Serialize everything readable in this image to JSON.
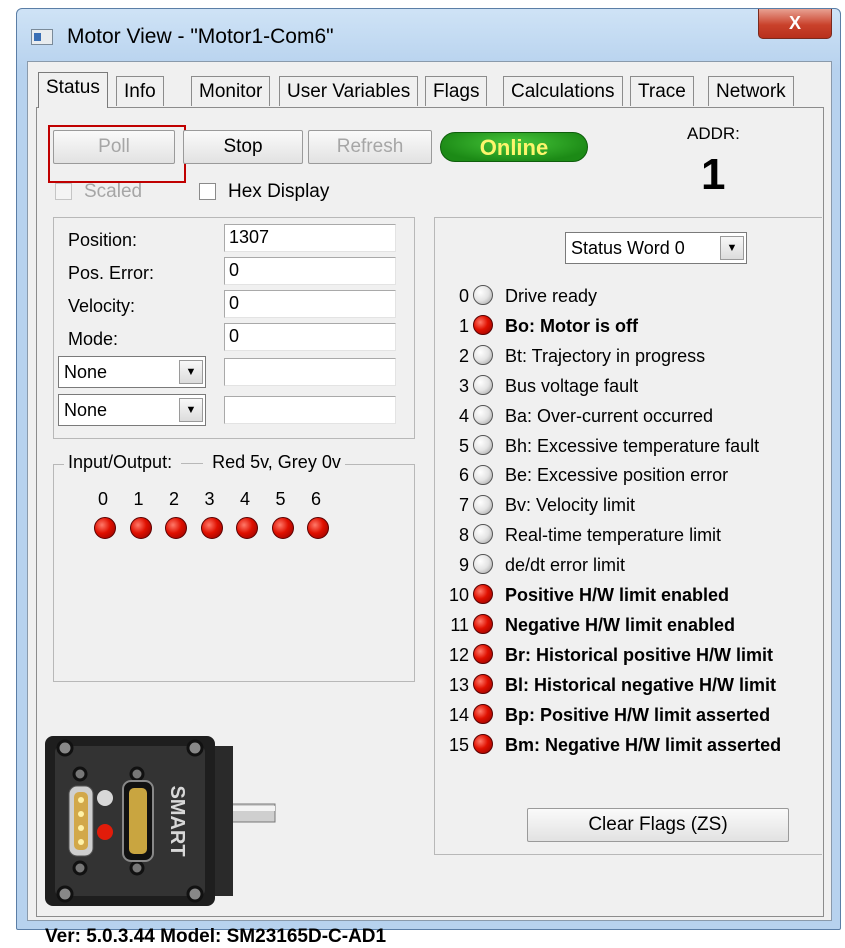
{
  "window": {
    "title": "Motor View - \"Motor1-Com6\"",
    "close_label": "X"
  },
  "tabs": [
    "Status",
    "Info",
    "Monitor",
    "User Variables",
    "Flags",
    "Calculations",
    "Trace",
    "Network"
  ],
  "toolbar": {
    "poll": "Poll",
    "stop": "Stop",
    "refresh": "Refresh",
    "online": "Online",
    "addr_label": "ADDR:",
    "addr_value": "1"
  },
  "options": {
    "scaled": "Scaled",
    "hex_display": "Hex Display"
  },
  "fields": [
    {
      "label": "Position:",
      "value": "1307"
    },
    {
      "label": "Pos. Error:",
      "value": "0"
    },
    {
      "label": "Velocity:",
      "value": "0"
    },
    {
      "label": "Mode:",
      "value": "0"
    }
  ],
  "selectors": [
    {
      "value": "None",
      "text": ""
    },
    {
      "value": "None",
      "text": ""
    }
  ],
  "io": {
    "title": "Input/Output:",
    "legend": "Red 5v, Grey 0v",
    "pins": [
      {
        "label": "0",
        "state": "red"
      },
      {
        "label": "1",
        "state": "red"
      },
      {
        "label": "2",
        "state": "red"
      },
      {
        "label": "3",
        "state": "red"
      },
      {
        "label": "4",
        "state": "red"
      },
      {
        "label": "5",
        "state": "red"
      },
      {
        "label": "6",
        "state": "red"
      }
    ]
  },
  "status_word": {
    "selected": "Status Word 0",
    "bits": [
      {
        "num": "0",
        "text": "Drive ready",
        "state": "grey"
      },
      {
        "num": "1",
        "text": "Bo:  Motor is off",
        "state": "red"
      },
      {
        "num": "2",
        "text": "Bt:  Trajectory in progress",
        "state": "grey"
      },
      {
        "num": "3",
        "text": "Bus voltage fault",
        "state": "grey"
      },
      {
        "num": "4",
        "text": "Ba:  Over-current occurred",
        "state": "grey"
      },
      {
        "num": "5",
        "text": "Bh:  Excessive temperature fault",
        "state": "grey"
      },
      {
        "num": "6",
        "text": "Be:  Excessive position error",
        "state": "grey"
      },
      {
        "num": "7",
        "text": "Bv:  Velocity limit",
        "state": "grey"
      },
      {
        "num": "8",
        "text": "Real-time temperature limit",
        "state": "grey"
      },
      {
        "num": "9",
        "text": "de/dt error limit",
        "state": "grey"
      },
      {
        "num": "10",
        "text": "Positive H/W limit enabled",
        "state": "red"
      },
      {
        "num": "11",
        "text": "Negative H/W limit enabled",
        "state": "red"
      },
      {
        "num": "12",
        "text": "Br:  Historical positive H/W limit",
        "state": "red"
      },
      {
        "num": "13",
        "text": "Bl:  Historical negative H/W limit",
        "state": "red"
      },
      {
        "num": "14",
        "text": "Bp:  Positive H/W limit asserted",
        "state": "red"
      },
      {
        "num": "15",
        "text": "Bm:  Negative H/W limit asserted",
        "state": "red"
      }
    ],
    "clear_button": "Clear Flags (ZS)"
  },
  "footer": {
    "version": "Ver: 5.0.3.44  Model:  SM23165D-C-AD1"
  },
  "motor_image": {
    "brand": "SMART"
  }
}
